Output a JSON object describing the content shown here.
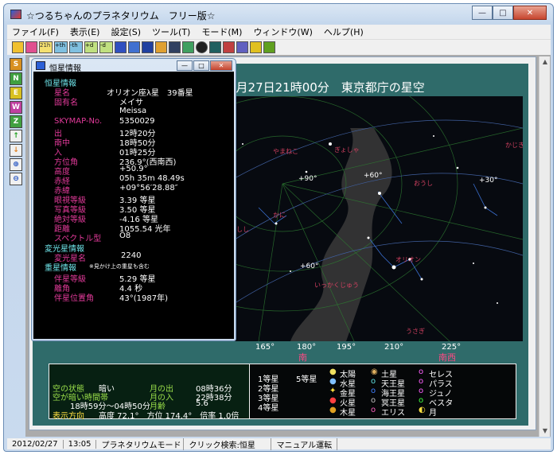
{
  "window": {
    "title": "☆つるちゃんのプラネタリウム　フリー版☆",
    "minimize": "—",
    "maximize": "□",
    "close": "✕"
  },
  "menu": [
    "ファイル(F)",
    "表示(E)",
    "設定(S)",
    "ツール(T)",
    "モード(M)",
    "ウィンドウ(W)",
    "ヘルプ(H)"
  ],
  "toolbar": {
    "tools": [
      "chart-icon",
      "planet-icon",
      "21h",
      "4th",
      "4th",
      "4d",
      "-1d",
      "star-icon",
      "constellation-icon",
      "grid-icon",
      "time-icon",
      "calendar-icon",
      "table-icon",
      "dot-icon",
      "telescope-icon",
      "comet-icon",
      "zoom-icon",
      "lightning-icon",
      "info-icon"
    ],
    "labels": {
      "t3": "21h",
      "t4": "+th",
      "t5": "-th",
      "t6": "+d",
      "t7": "-d"
    }
  },
  "sidetools": [
    "S",
    "N",
    "E",
    "W",
    "Z",
    "↑",
    "↓",
    "⊕",
    "⊖"
  ],
  "sky": {
    "title": "2月27日21時00分　東京都庁の星空",
    "deg_labels": [
      "165°",
      "180°",
      "195°",
      "210°",
      "225°"
    ],
    "dir_labels": [
      "南",
      "南西"
    ],
    "alt_labels": [
      "+90°",
      "+60°",
      "+30°",
      "+60°"
    ],
    "constellations": [
      "やまねこ",
      "ぎょしゃ",
      "おうし",
      "オリオン",
      "いっかくじゅう",
      "うさぎ",
      "しし",
      "かに",
      "かじき"
    ]
  },
  "info": {
    "rows": [
      {
        "label": "空の状態",
        "value": "暗い",
        "label2": "月の出",
        "value2": "08時36分"
      },
      {
        "label": "空が暗い時間帯",
        "value": "",
        "label2": "月の入",
        "value2": "22時38分"
      },
      {
        "label": "",
        "value": "18時59分〜04時50分",
        "label2": "月齢",
        "value2": "5.6"
      }
    ],
    "direction_label": "表示方向",
    "direction_value": "高度 72.1°　方位 174.4°　倍率 1.0倍"
  },
  "legend": {
    "magnitudes": [
      "1等星",
      "2等星",
      "3等星",
      "4等星",
      "5等星"
    ],
    "bodies": [
      [
        "太陽",
        "土星",
        "セレス"
      ],
      [
        "水星",
        "天王星",
        "パラス"
      ],
      [
        "金星",
        "海王星",
        "ジュノ"
      ],
      [
        "火星",
        "冥王星",
        "ベスタ"
      ],
      [
        "木星",
        "エリス",
        "月"
      ]
    ]
  },
  "status": [
    "2012/02/27",
    "13:05",
    "プラネタリウムモード",
    "クリック検索:恒星",
    "マニュアル運転"
  ],
  "dialog": {
    "title": "恒星情報",
    "section1": "恒星情報",
    "star_name_label": "星名",
    "star_name": "オリオン座λ星　39番星",
    "proper_name_label": "固有名",
    "proper_name": "メイサ",
    "proper_name_en": "Meissa",
    "rows": [
      {
        "k": "SKYMAP-No.",
        "v": "5350029"
      },
      {
        "k": "出",
        "v": "12時20分"
      },
      {
        "k": "南中",
        "v": "18時50分"
      },
      {
        "k": "入",
        "v": "01時25分"
      },
      {
        "k": "方位角",
        "v": "236.9°(西南西)"
      },
      {
        "k": "高度",
        "v": "+50.9°"
      },
      {
        "k": "赤経",
        "v": "05h 35m 48.49s"
      },
      {
        "k": "赤緯",
        "v": "+09°56′28.88″"
      },
      {
        "k": "眼視等級",
        "v": "3.39 等星"
      },
      {
        "k": "写真等級",
        "v": "3.50 等星"
      },
      {
        "k": "絶対等級",
        "v": "-4.16 等星"
      },
      {
        "k": "距離",
        "v": "1055.54 光年"
      },
      {
        "k": "スペクトル型",
        "v": "O8"
      }
    ],
    "section2": "変光星情報",
    "var_label": "変光星名",
    "var_value": "2240",
    "section3": "重星情報",
    "section3_note": "※見かけ上の重星も含む",
    "dbl_rows": [
      {
        "k": "伴星等級",
        "v": "5.29 等星"
      },
      {
        "k": "離角",
        "v": "4.4 秒"
      },
      {
        "k": "伴星位置角",
        "v": "43°(1987年)"
      }
    ]
  }
}
